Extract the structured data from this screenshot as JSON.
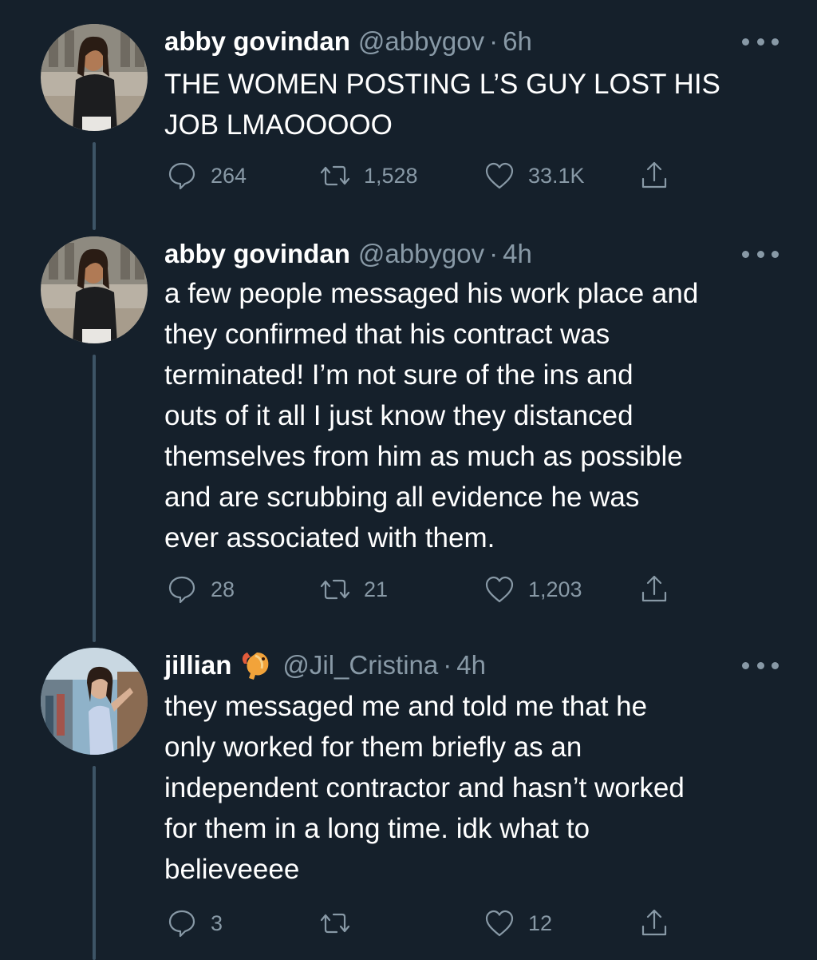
{
  "tweets": [
    {
      "name": "abby govindan",
      "handle": "@abbygov",
      "separator": "·",
      "time": "6h",
      "text": "THE WOMEN POSTING L’S GUY LOST HIS\nJOB LMAOOOOO",
      "replies": "264",
      "retweets": "1,528",
      "likes": "33.1K"
    },
    {
      "name": "abby govindan",
      "handle": "@abbygov",
      "separator": "·",
      "time": "4h",
      "text": "a few people messaged his work place and\nthey confirmed that his contract was\nterminated! I’m not sure of the ins and\nouts of it all I just know they distanced\nthemselves from him as much as possible\nand are scrubbing all evidence he was\never associated with them.",
      "replies": "28",
      "retweets": "21",
      "likes": "1,203"
    },
    {
      "name": "jillian",
      "name_emoji": "shrimp-icon",
      "handle": "@Jil_Cristina",
      "separator": "·",
      "time": "4h",
      "text": "they messaged me and told me that he\nonly worked for them briefly as an\nindependent contractor and hasn’t worked\nfor them in a long time. idk what to\nbelieveeee",
      "replies": "3",
      "retweets": "",
      "likes": "12"
    }
  ],
  "colors": {
    "background": "#15202b",
    "text": "#ffffff",
    "secondary_text": "#8899a6",
    "thread_line": "#3d5466"
  }
}
